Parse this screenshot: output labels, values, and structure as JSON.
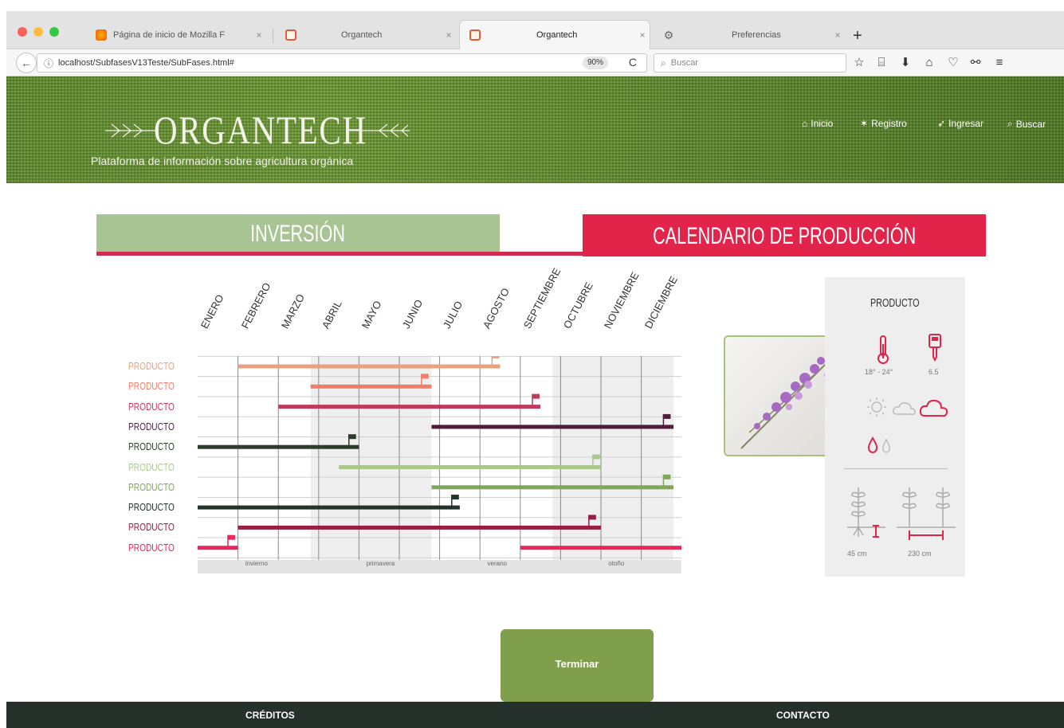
{
  "browser": {
    "tabs": [
      {
        "title": "Página de inicio de Mozilla F",
        "favicon": "firefox-icon"
      },
      {
        "title": "Organtech",
        "favicon": "organtech-icon"
      },
      {
        "title": "Organtech",
        "favicon": "organtech-icon"
      },
      {
        "title": "Preferencias",
        "favicon": "gear-icon"
      }
    ],
    "active_tab": 2,
    "close_glyph": "×",
    "new_tab_glyph": "+",
    "url": "localhost/SubfasesV13Teste/SubFases.html#",
    "zoom": "90%",
    "search_placeholder": "Buscar"
  },
  "site": {
    "logo": "ORGANTECH",
    "tagline": "Plataforma de información sobre agricultura orgánica",
    "nav": [
      {
        "label": "Inicio",
        "icon": "home-icon"
      },
      {
        "label": "Registro",
        "icon": "star-icon"
      },
      {
        "label": "Ingresar",
        "icon": "send-icon"
      },
      {
        "label": "Buscar",
        "icon": "search-icon"
      }
    ]
  },
  "sections": {
    "inversion": "INVERSIÓN",
    "calendario": "CALENDARIO DE PRODUCCIÓN"
  },
  "calendar": {
    "months": [
      "ENERO",
      "FEBRERO",
      "MARZO",
      "ABRIL",
      "MAYO",
      "JUNIO",
      "JULIO",
      "AGOSTO",
      "SEPTIEMBRE",
      "OCTUBRE",
      "NOVIEMBRE",
      "DICIEMBRE"
    ],
    "seasons": [
      {
        "label": "invierno",
        "start": 0,
        "end": 3
      },
      {
        "label": "primavera",
        "start": 3,
        "end": 6
      },
      {
        "label": "verano",
        "start": 6,
        "end": 9
      },
      {
        "label": "otoño",
        "start": 9,
        "end": 12
      }
    ],
    "rows": [
      {
        "label": "PRODUCTO",
        "color": "#e8a27f",
        "start": 1.0,
        "end": 7.5,
        "flag": 7.3
      },
      {
        "label": "PRODUCTO",
        "color": "#ef7f6a",
        "start": 2.8,
        "end": 5.8,
        "flag": 5.55
      },
      {
        "label": "PRODUCTO",
        "color": "#c03a5b",
        "start": 2.0,
        "end": 8.5,
        "flag": 8.3
      },
      {
        "label": "PRODUCTO",
        "color": "#4f1e3f",
        "start": 5.8,
        "end": 11.8,
        "flag": 11.55
      },
      {
        "label": "PRODUCTO",
        "color": "#2c3d2c",
        "start": 0.0,
        "end": 4.0,
        "flag": 3.75
      },
      {
        "label": "PRODUCTO",
        "color": "#aac88e",
        "start": 3.5,
        "end": 10.0,
        "flag": 9.8
      },
      {
        "label": "PRODUCTO",
        "color": "#7fa75a",
        "start": 5.8,
        "end": 11.8,
        "flag": 11.55
      },
      {
        "label": "PRODUCTO",
        "color": "#22332a",
        "start": 0.0,
        "end": 6.5,
        "flag": 6.3
      },
      {
        "label": "PRODUCTO",
        "color": "#9a1d42",
        "start": 1.0,
        "end": 10.0,
        "flag": 9.7
      },
      {
        "label": "PRODUCTO",
        "color": "#e8285a",
        "start": 0.0,
        "end": 1.0,
        "flag": 0.75,
        "start2": 8.0,
        "end2": 12.0
      }
    ],
    "shaded_months": [
      [
        2.8,
        5.8
      ],
      [
        8.8,
        11.8
      ]
    ]
  },
  "product": {
    "title": "PRODUCTO",
    "temperature": "18° - 24°",
    "ph": "6.5",
    "height": "45 cm",
    "spacing": "230 cm",
    "icons": [
      "thermometer-icon",
      "ph-meter-icon",
      "sun-icon",
      "cloud-icon",
      "cloud-rain-icon",
      "drop-icon",
      "drop-outline-icon",
      "plant-height-icon",
      "plant-spacing-icon"
    ]
  },
  "actions": {
    "finish": "Terminar"
  },
  "footer": {
    "credits": "CRÉDITOS",
    "contact": "CONTACTO"
  }
}
